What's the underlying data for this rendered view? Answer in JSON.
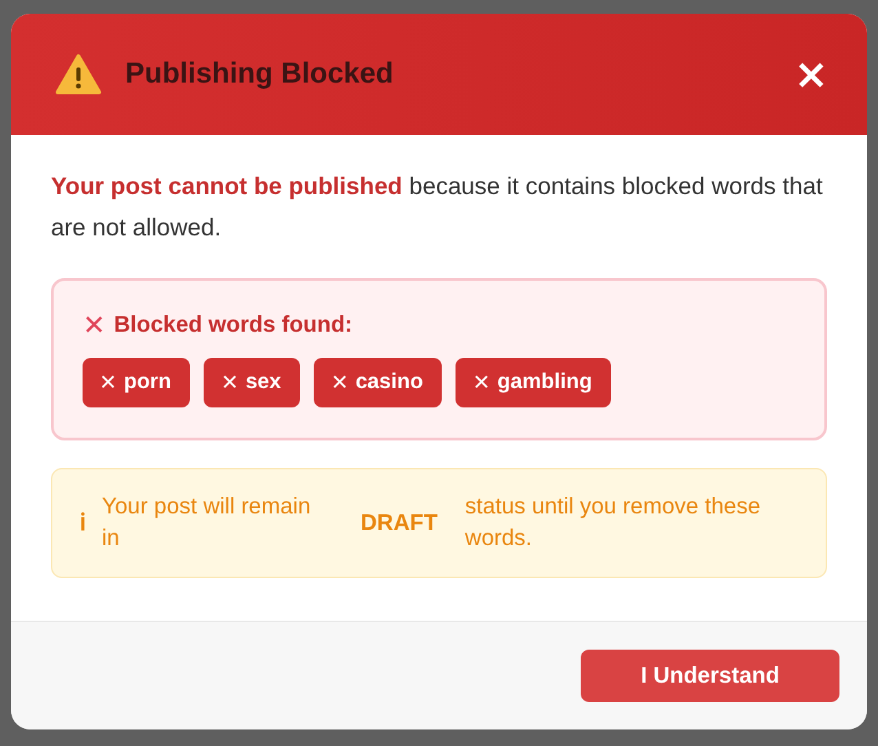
{
  "dialog": {
    "title": "Publishing Blocked",
    "close": "×"
  },
  "message": {
    "lead": "Your post cannot be published",
    "rest": "because it contains blocked words that are not allowed."
  },
  "blocked": {
    "icon": "✕",
    "heading": "Blocked words found:",
    "words": [
      {
        "mark": "✕",
        "label": "porn"
      },
      {
        "mark": "✕",
        "label": "sex"
      },
      {
        "mark": "✕",
        "label": "casino"
      },
      {
        "mark": "✕",
        "label": "gambling"
      }
    ]
  },
  "notice": {
    "icon": "ℹ",
    "before": "Your post will remain in",
    "status": "DRAFT",
    "after": "status until you remove these words."
  },
  "buttons": [
    {
      "label": "I Understand"
    }
  ]
}
